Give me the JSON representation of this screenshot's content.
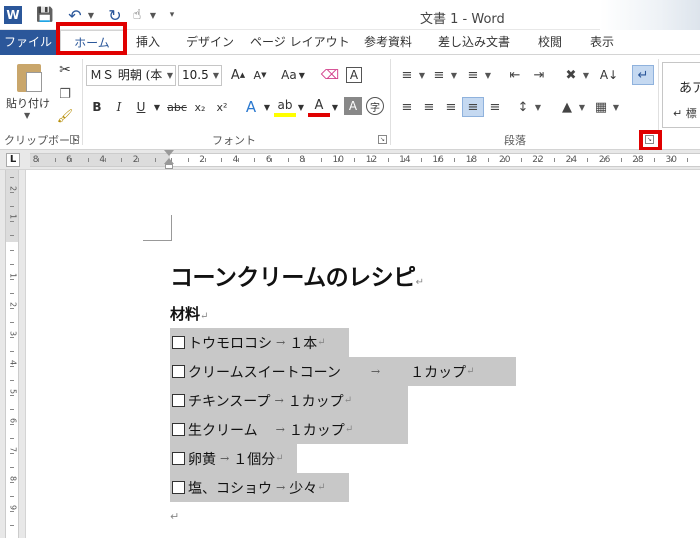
{
  "window": {
    "title": "文書 1 - Word"
  },
  "quick_access": {
    "app_icon_text": "W"
  },
  "tabs": [
    "ファイル",
    "ホーム",
    "挿入",
    "デザイン",
    "ページ レイアウト",
    "参考資料",
    "差し込み文書",
    "校閲",
    "表示"
  ],
  "ribbon": {
    "clipboard": {
      "paste_label": "貼り付け",
      "group_label": "クリップボード"
    },
    "font": {
      "font_name": "ＭＳ 明朝 (本",
      "font_size": "10.5",
      "change_case_label": "Aa",
      "bold": "B",
      "italic": "I",
      "underline": "U",
      "strike": "abc",
      "subscript": "x₂",
      "superscript": "x²",
      "effects": "A",
      "highlight": "ab",
      "font_color": "A",
      "shade": "A",
      "enclose": "字",
      "grow": "A",
      "shrink": "A",
      "group_label": "フォント"
    },
    "paragraph": {
      "group_label": "段落"
    },
    "styles": {
      "sample": "あア",
      "second_label": "↵ 標"
    }
  },
  "ruler": {
    "h_numbers": [
      "8",
      "6",
      "4",
      "2",
      "2",
      "4",
      "6",
      "8",
      "10",
      "12",
      "14",
      "16",
      "18",
      "20",
      "22",
      "24",
      "26",
      "28",
      "30"
    ],
    "v_numbers": [
      "2",
      "1",
      "1",
      "2",
      "3",
      "4",
      "5",
      "6",
      "7",
      "8",
      "9",
      "10"
    ]
  },
  "document": {
    "title": "コーンクリームのレシピ",
    "ingredients_heading": "材料",
    "items": [
      {
        "name": "トウモロコシ",
        "qty": "１本"
      },
      {
        "name": "クリームスイートコーン　",
        "qty": "　１カップ"
      },
      {
        "name": "チキンスープ",
        "qty": "１カップ"
      },
      {
        "name": "生クリーム　",
        "qty": "１カップ"
      },
      {
        "name": "卵黄",
        "qty": "１個分"
      },
      {
        "name": "塩、コショウ",
        "qty": "少々"
      }
    ],
    "para_mark": "↵",
    "tab_mark": "→"
  },
  "colors": {
    "word_blue": "#2b579a",
    "highlight_red": "#e00000",
    "selection_gray": "#c8c8c8"
  }
}
